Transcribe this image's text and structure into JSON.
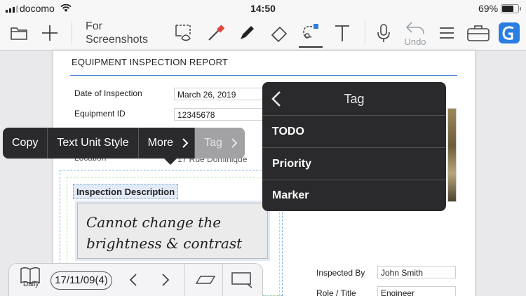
{
  "status_bar": {
    "carrier": "docomo",
    "time": "14:50",
    "battery": "69%",
    "battery_level": 0.69
  },
  "toolbar": {
    "notebook_title": "For\nScreenshots",
    "undo_label": "Undo",
    "icons": [
      "folder-icon",
      "plus-icon",
      "lasso-select-icon",
      "dropper-icon",
      "pen-icon",
      "eraser-icon",
      "shape-lasso-icon",
      "text-icon",
      "microphone-icon",
      "undo-icon",
      "list-icon",
      "toolbox-icon",
      "app-logo-icon"
    ]
  },
  "document": {
    "title": "EQUIPMENT INSPECTION REPORT",
    "fields": [
      {
        "label": "Date of Inspection",
        "value": "March 26, 2019"
      },
      {
        "label": "Equipment ID",
        "value": "12345678"
      },
      {
        "label": "Location",
        "value": "17 Rue Dominique"
      }
    ],
    "description_title": "Inspection Description",
    "handwriting": "Cannot change the\nbrightness & contrast",
    "inspected_by_label": "Inspected By",
    "inspected_by_value": "John Smith",
    "role_label": "Role / Title",
    "role_value": "Engineer"
  },
  "context_menu": {
    "items": [
      "Copy",
      "Text Unit Style",
      "More",
      "Tag"
    ]
  },
  "tag_menu": {
    "title": "Tag",
    "options": [
      "TODO",
      "Priority",
      "Marker"
    ]
  },
  "bottom_nav": {
    "daily_label": "Daily",
    "date": "17/11/09(4)"
  },
  "colors": {
    "accent": "#2f7fd6",
    "menu_bg": "#2a2a2c",
    "tag_highlight": "#a2a2a5"
  }
}
